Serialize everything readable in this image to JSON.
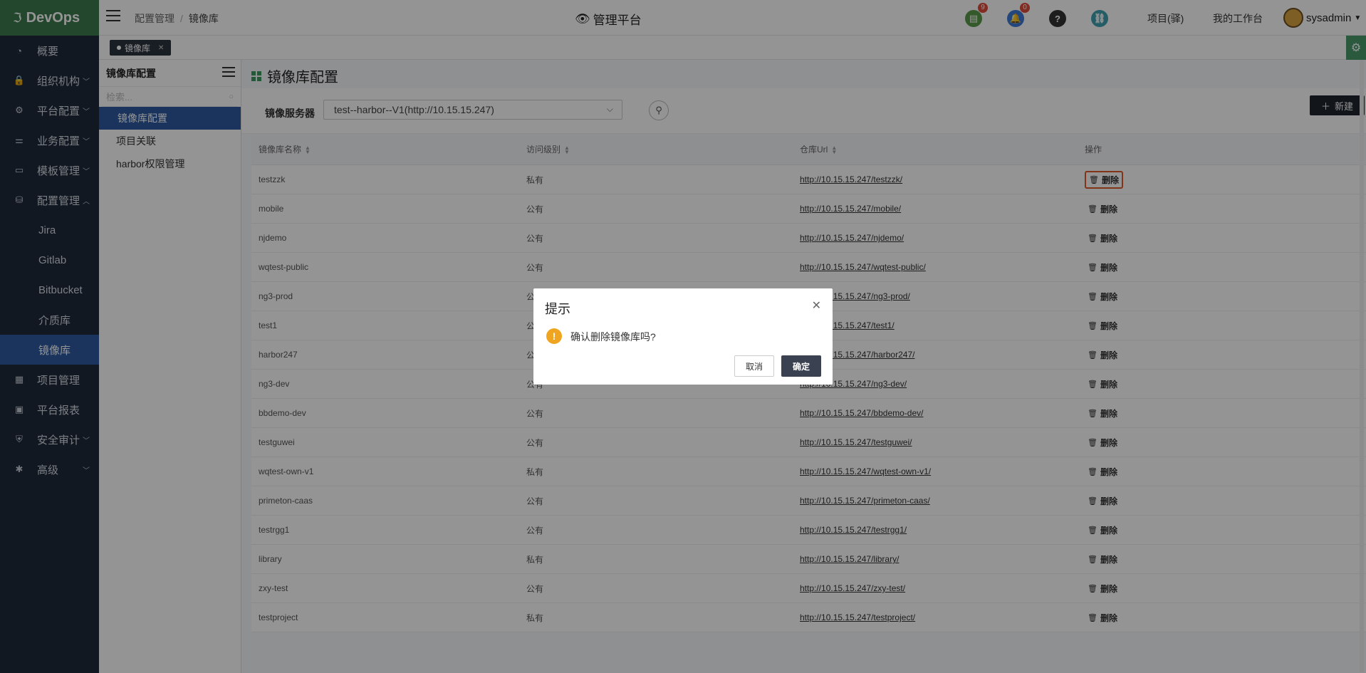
{
  "app": {
    "logo": "DevOps"
  },
  "sidebar": {
    "items": [
      {
        "label": "概要",
        "icon": "dashboard-icon"
      },
      {
        "label": "组织机构",
        "icon": "lock-icon",
        "expandable": true
      },
      {
        "label": "平台配置",
        "icon": "gear-icon",
        "expandable": true
      },
      {
        "label": "业务配置",
        "icon": "sliders-icon",
        "expandable": true
      },
      {
        "label": "模板管理",
        "icon": "template-icon",
        "expandable": true
      },
      {
        "label": "配置管理",
        "icon": "database-icon",
        "expandable": true,
        "expanded": true
      }
    ],
    "sub_items": [
      "Jira",
      "Gitlab",
      "Bitbucket",
      "介质库",
      "镜像库"
    ],
    "items_after": [
      {
        "label": "项目管理",
        "icon": "grid-icon"
      },
      {
        "label": "平台报表",
        "icon": "monitor-icon"
      },
      {
        "label": "安全审计",
        "icon": "shield-icon",
        "expandable": true
      },
      {
        "label": "高级",
        "icon": "advanced-icon",
        "expandable": true
      }
    ]
  },
  "header": {
    "breadcrumb_parent": "配置管理",
    "breadcrumb_sep": "/",
    "breadcrumb_current": "镜像库",
    "platform_title": "管理平台",
    "task_badge": "9",
    "bell_badge": "0",
    "help_icon": "?",
    "link_project": "项目(驿)",
    "link_workbench": "我的工作台",
    "user": "sysadmin"
  },
  "tabs": {
    "active_tab": "镜像库"
  },
  "left_panel": {
    "title": "镜像库配置",
    "search_placeholder": "检索...",
    "items": [
      "镜像库配置",
      "项目关联",
      "harbor权限管理"
    ]
  },
  "main": {
    "page_title": "镜像库配置",
    "filter_label": "镜像服务器",
    "server_selected": "test--harbor--V1(http://10.15.15.247)",
    "new_button": "新建",
    "columns": [
      "镜像库名称",
      "访问级别",
      "仓库Url",
      "操作"
    ],
    "delete_label": "删除",
    "rows": [
      {
        "name": "testzzk",
        "level": "私有",
        "url": "http://10.15.15.247/testzzk/"
      },
      {
        "name": "mobile",
        "level": "公有",
        "url": "http://10.15.15.247/mobile/"
      },
      {
        "name": "njdemo",
        "level": "公有",
        "url": "http://10.15.15.247/njdemo/"
      },
      {
        "name": "wqtest-public",
        "level": "公有",
        "url": "http://10.15.15.247/wqtest-public/"
      },
      {
        "name": "ng3-prod",
        "level": "公有",
        "url": "http://10.15.15.247/ng3-prod/"
      },
      {
        "name": "test1",
        "level": "公有",
        "url": "http://10.15.15.247/test1/"
      },
      {
        "name": "harbor247",
        "level": "公有",
        "url": "http://10.15.15.247/harbor247/"
      },
      {
        "name": "ng3-dev",
        "level": "公有",
        "url": "http://10.15.15.247/ng3-dev/"
      },
      {
        "name": "bbdemo-dev",
        "level": "公有",
        "url": "http://10.15.15.247/bbdemo-dev/"
      },
      {
        "name": "testguwei",
        "level": "公有",
        "url": "http://10.15.15.247/testguwei/"
      },
      {
        "name": "wqtest-own-v1",
        "level": "私有",
        "url": "http://10.15.15.247/wqtest-own-v1/"
      },
      {
        "name": "primeton-caas",
        "level": "公有",
        "url": "http://10.15.15.247/primeton-caas/"
      },
      {
        "name": "testrgg1",
        "level": "公有",
        "url": "http://10.15.15.247/testrgg1/"
      },
      {
        "name": "library",
        "level": "私有",
        "url": "http://10.15.15.247/library/"
      },
      {
        "name": "zxy-test",
        "level": "公有",
        "url": "http://10.15.15.247/zxy-test/"
      },
      {
        "name": "testproject",
        "level": "私有",
        "url": "http://10.15.15.247/testproject/"
      }
    ]
  },
  "dialog": {
    "title": "提示",
    "message": "确认删除镜像库吗?",
    "cancel": "取消",
    "ok": "确定"
  },
  "colors": {
    "sidebar_bg": "#1f2a3a",
    "logo_bg": "#3c7a4e",
    "active_blue": "#2d5aa0",
    "highlight": "#e05a2a",
    "warn": "#f0a520"
  }
}
